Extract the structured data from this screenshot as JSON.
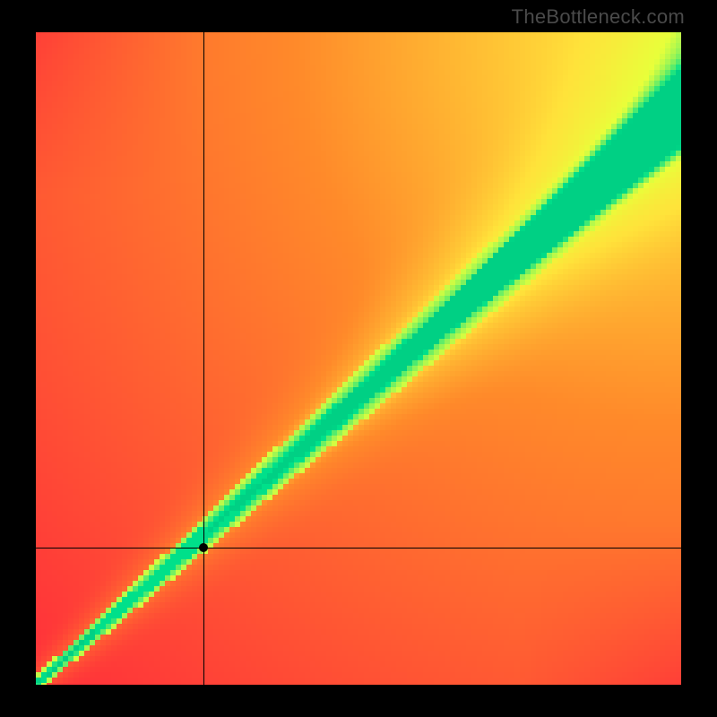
{
  "watermark": "TheBottleneck.com",
  "chart_data": {
    "type": "heatmap",
    "title": "",
    "xlabel": "",
    "ylabel": "",
    "xlim": [
      0,
      1
    ],
    "ylim": [
      0,
      1
    ],
    "grid": false,
    "legend": false,
    "color_stops": [
      {
        "t": 0.0,
        "color": "#ff2a3b"
      },
      {
        "t": 0.45,
        "color": "#ff8a2a"
      },
      {
        "t": 0.7,
        "color": "#ffe23a"
      },
      {
        "t": 0.86,
        "color": "#e8ff3a"
      },
      {
        "t": 0.985,
        "color": "#00e08a"
      },
      {
        "t": 1.0,
        "color": "#00d084"
      }
    ],
    "ridge": {
      "slope": 0.88,
      "intercept": 0.0,
      "width_start": 0.03,
      "width_end": 0.18,
      "description": "Optimal diagonal band widening toward top-right"
    },
    "marker": {
      "x": 0.26,
      "y": 0.21
    },
    "annotations": []
  }
}
